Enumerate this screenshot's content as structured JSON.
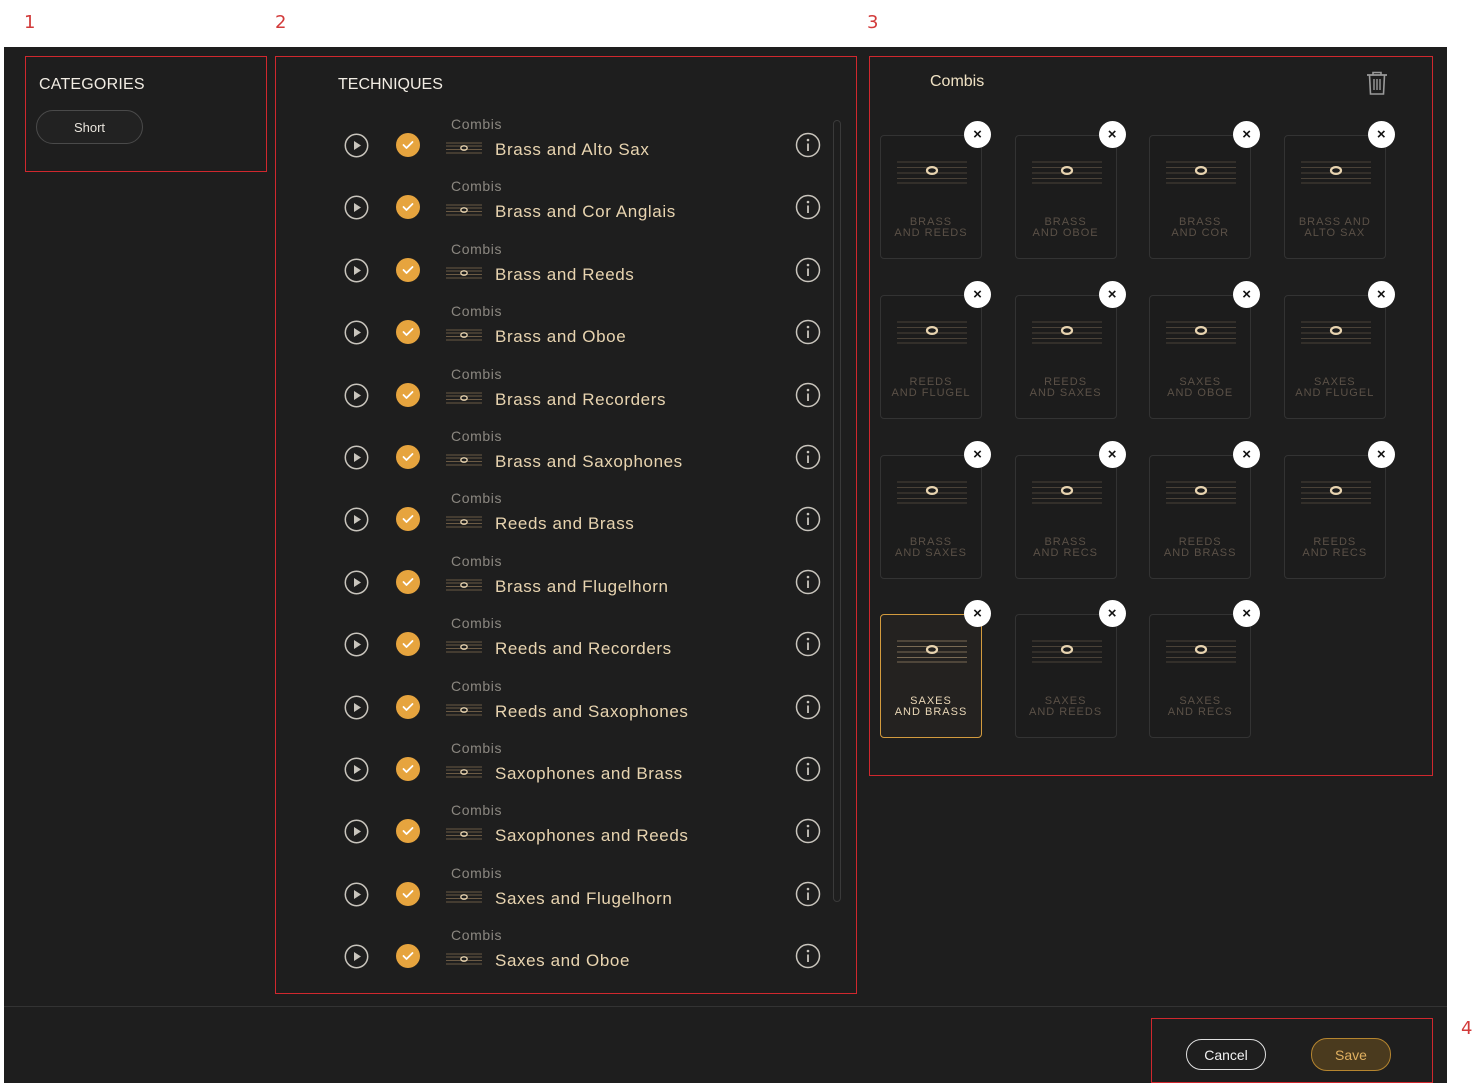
{
  "annotations": [
    "1",
    "2",
    "3",
    "4"
  ],
  "categories": {
    "title": "CATEGORIES",
    "items": [
      "Short"
    ]
  },
  "techniques": {
    "title": "TECHNIQUES",
    "rows": [
      {
        "category": "Combis",
        "name": "Brass and Alto Sax"
      },
      {
        "category": "Combis",
        "name": "Brass and Cor Anglais"
      },
      {
        "category": "Combis",
        "name": "Brass and Reeds"
      },
      {
        "category": "Combis",
        "name": "Brass and Oboe"
      },
      {
        "category": "Combis",
        "name": "Brass and Recorders"
      },
      {
        "category": "Combis",
        "name": "Brass and Saxophones"
      },
      {
        "category": "Combis",
        "name": "Reeds and Brass"
      },
      {
        "category": "Combis",
        "name": "Brass and Flugelhorn"
      },
      {
        "category": "Combis",
        "name": "Reeds and Recorders"
      },
      {
        "category": "Combis",
        "name": "Reeds and Saxophones"
      },
      {
        "category": "Combis",
        "name": "Saxophones and Brass"
      },
      {
        "category": "Combis",
        "name": "Saxophones and Reeds"
      },
      {
        "category": "Combis",
        "name": "Saxes and Flugelhorn"
      },
      {
        "category": "Combis",
        "name": "Saxes and Oboe"
      }
    ]
  },
  "combis": {
    "title": "Combis",
    "tiles": [
      {
        "label": "BRASS\nAND REEDS",
        "selected": false
      },
      {
        "label": "BRASS\nAND OBOE",
        "selected": false
      },
      {
        "label": "BRASS\nAND COR",
        "selected": false
      },
      {
        "label": "BRASS AND\nALTO SAX",
        "selected": false
      },
      {
        "label": "REEDS\nAND FLUGEL",
        "selected": false
      },
      {
        "label": "REEDS\nAND SAXES",
        "selected": false
      },
      {
        "label": "SAXES\nAND OBOE",
        "selected": false
      },
      {
        "label": "SAXES\nAND FLUGEL",
        "selected": false
      },
      {
        "label": "BRASS\nAND SAXES",
        "selected": false
      },
      {
        "label": "BRASS\nAND RECS",
        "selected": false
      },
      {
        "label": "REEDS\nAND BRASS",
        "selected": false
      },
      {
        "label": "REEDS\nAND RECS",
        "selected": false
      },
      {
        "label": "SAXES\nAND BRASS",
        "selected": true
      },
      {
        "label": "SAXES\nAND REEDS",
        "selected": false
      },
      {
        "label": "SAXES\nAND RECS",
        "selected": false
      }
    ]
  },
  "footer": {
    "cancel_label": "Cancel",
    "save_label": "Save"
  },
  "colors": {
    "accent": "#e6a43e",
    "annotation": "#d0282e",
    "background": "#1e1e1e"
  }
}
